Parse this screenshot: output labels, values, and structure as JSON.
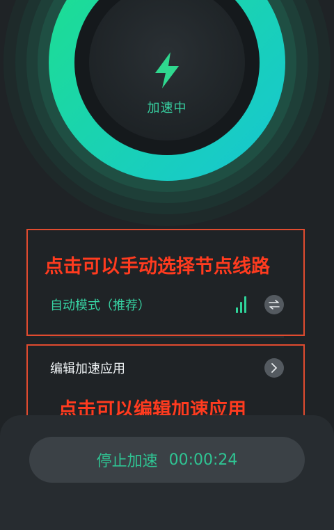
{
  "dial": {
    "status": "加速中"
  },
  "route": {
    "annotation": "点击可以手动选择节点线路",
    "mode_label": "自动模式（推荐）",
    "signal_level": 3,
    "signal_max": 3
  },
  "apps": {
    "label": "编辑加速应用",
    "annotation": "点击可以编辑加速应用"
  },
  "stop_button": {
    "label": "停止加速",
    "timer": "00:00:24"
  },
  "colors": {
    "background": "#1f2326",
    "accent_green": "#37d2a2",
    "annotation_red": "#ff3b1f",
    "ring_gradient_start": "#1ee08c",
    "ring_gradient_end": "#16c6d4"
  },
  "icons": {
    "dial": "lightning-bolt-icon",
    "route_signal": "signal-bars-icon",
    "route_switch": "swap-arrows-icon",
    "apps_arrow": "chevron-right-icon"
  }
}
